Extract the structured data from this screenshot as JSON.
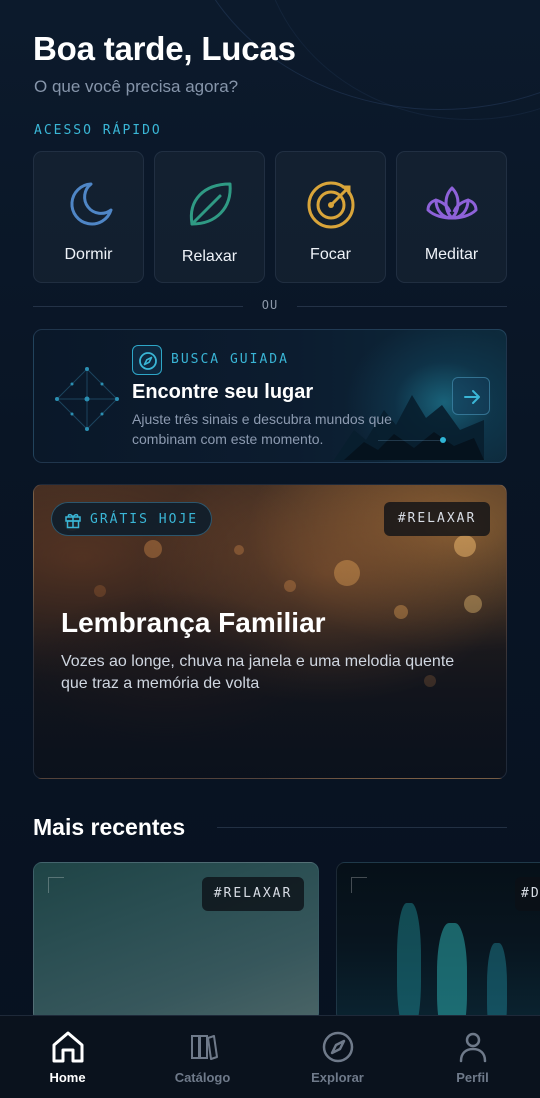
{
  "header": {
    "greeting": "Boa tarde, Lucas",
    "subtitle": "O que você precisa agora?"
  },
  "quick_access": {
    "label": "ACESSO RÁPIDO",
    "items": [
      {
        "label": "Dormir",
        "icon": "moon-icon",
        "color": "#4f86c6"
      },
      {
        "label": "Relaxar",
        "icon": "leaf-icon",
        "color": "#2f9a84"
      },
      {
        "label": "Focar",
        "icon": "target-icon",
        "color": "#d9a53a"
      },
      {
        "label": "Meditar",
        "icon": "lotus-icon",
        "color": "#8e62d9"
      }
    ]
  },
  "divider_label": "OU",
  "guided_search": {
    "label": "BUSCA GUIADA",
    "title": "Encontre seu lugar",
    "description": "Ajuste três sinais e descubra mundos que combinam com este momento.",
    "icon": "compass-icon",
    "action_icon": "arrow-right-icon"
  },
  "featured": {
    "badge": "GRÁTIS HOJE",
    "badge_icon": "gift-icon",
    "tag": "#RELAXAR",
    "title": "Lembrança Familiar",
    "description": "Vozes ao longe, chuva na janela e uma melodia quente que traz a memória de volta"
  },
  "recent": {
    "title": "Mais recentes",
    "cards": [
      {
        "tag": "#RELAXAR"
      },
      {
        "tag": "#D"
      }
    ]
  },
  "nav": {
    "items": [
      {
        "label": "Home",
        "icon": "home-icon",
        "active": true
      },
      {
        "label": "Catálogo",
        "icon": "books-icon",
        "active": false
      },
      {
        "label": "Explorar",
        "icon": "compass-icon",
        "active": false
      },
      {
        "label": "Perfil",
        "icon": "user-icon",
        "active": false
      }
    ]
  },
  "colors": {
    "accent": "#3ab6d6",
    "background": "#091525",
    "text_muted": "#8695aa"
  }
}
